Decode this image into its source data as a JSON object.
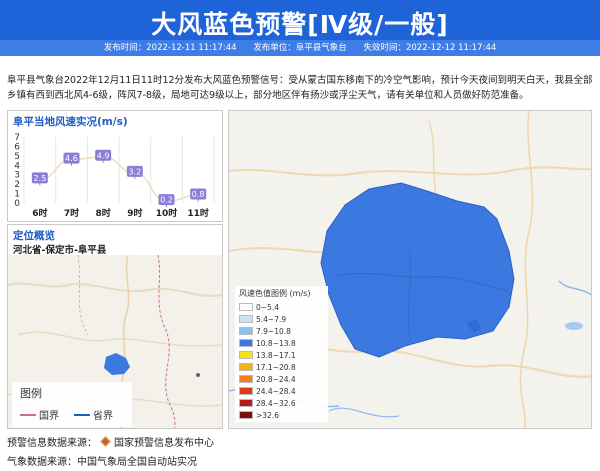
{
  "header": {
    "title": "大风蓝色预警[Ⅳ级/一般]",
    "issue_time_label": "发布时间：",
    "issue_time": "2022-12-11 11:17:44",
    "issuer_label": "发布单位：",
    "issuer": "阜平县气象台",
    "expire_label": "失效时间：",
    "expire_time": "2022-12-12 11:17:44",
    "accent_color": "#1f63d8"
  },
  "description": "阜平县气象台2022年12月11日11时12分发布大风蓝色预警信号：受从蒙古国东移南下的冷空气影响，预计今天夜间到明天白天，我县全部乡镇有西到西北风4-6级，阵风7-8级，局地可达9级以上，部分地区伴有扬沙或浮尘天气，请有关单位和人员做好防范准备。",
  "wind_panel": {
    "title": "阜平当地风速实况(m/s)"
  },
  "chart_data": {
    "type": "line",
    "title": "阜平当地风速实况(m/s)",
    "categories": [
      "6时",
      "7时",
      "8时",
      "9时",
      "10时",
      "11时"
    ],
    "values": [
      2.5,
      4.6,
      4.9,
      3.2,
      0.2,
      0.8
    ],
    "y_ticks": [
      "0",
      "1",
      "2",
      "3",
      "4",
      "5",
      "6",
      "7"
    ],
    "ylim": [
      0,
      7
    ],
    "label_color": "#8a7fd6",
    "grid": true
  },
  "location_panel": {
    "title": "定位概览",
    "location": "河北省-保定市-阜平县",
    "legend_title": "图例",
    "legend_items": [
      {
        "label": "国界",
        "color": "#c9708a"
      },
      {
        "label": "省界",
        "color": "#1f5cc6"
      }
    ]
  },
  "map": {
    "legend_title": "风速色值图例 (m/s)",
    "legend": [
      {
        "label": "0~5.4",
        "color": "#ffffff"
      },
      {
        "label": "5.4~7.9",
        "color": "#c7e3f7"
      },
      {
        "label": "7.9~10.8",
        "color": "#86c2ef"
      },
      {
        "label": "10.8~13.8",
        "color": "#3b78e0"
      },
      {
        "label": "13.8~17.1",
        "color": "#f4e21f"
      },
      {
        "label": "17.1~20.8",
        "color": "#f6b21c"
      },
      {
        "label": "20.8~24.4",
        "color": "#f27f1c"
      },
      {
        "label": "24.4~28.4",
        "color": "#e2361b"
      },
      {
        "label": "28.4~32.6",
        "color": "#b51a1a"
      },
      {
        "label": ">32.6",
        "color": "#7a0d0d"
      }
    ],
    "warning_area_color": "#3b78e0"
  },
  "footer": {
    "source_label": "预警信息数据来源：",
    "source_name": "国家预警信息发布中心",
    "weather_label": "气象数据来源：",
    "weather_name": "中国气象局全国自动站实况"
  }
}
